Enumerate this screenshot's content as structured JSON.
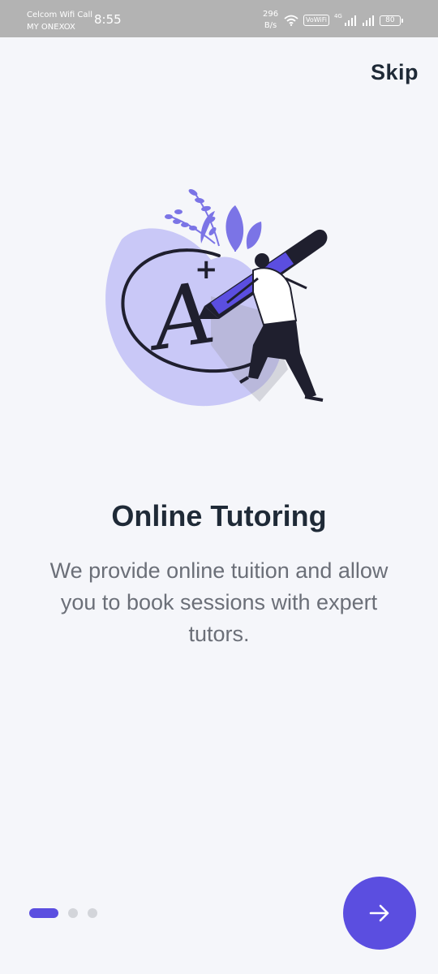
{
  "status_bar": {
    "carrier_line1": "Celcom Wifi Call",
    "carrier_line2": "MY ONEXOX",
    "time": "8:55",
    "speed_value": "296",
    "speed_unit": "B/s",
    "vowifi": "VoWiFi",
    "network": "4G",
    "battery": "80"
  },
  "header": {
    "skip_label": "Skip"
  },
  "onboarding": {
    "title": "Online Tutoring",
    "description": "We provide online tuition and allow you to book sessions with expert tutors.",
    "illustration": {
      "grade_letter": "A",
      "grade_sign": "+"
    },
    "current_page": 1,
    "total_pages": 3
  },
  "colors": {
    "accent": "#5b4ee0",
    "blob": "#c9c8f7",
    "heading": "#1f2a37",
    "body_text": "#6b6f78",
    "background": "#f5f6fa"
  },
  "icons": {
    "next": "arrow-right-icon",
    "wifi": "wifi-icon",
    "signal": "signal-icon",
    "battery": "battery-icon"
  }
}
